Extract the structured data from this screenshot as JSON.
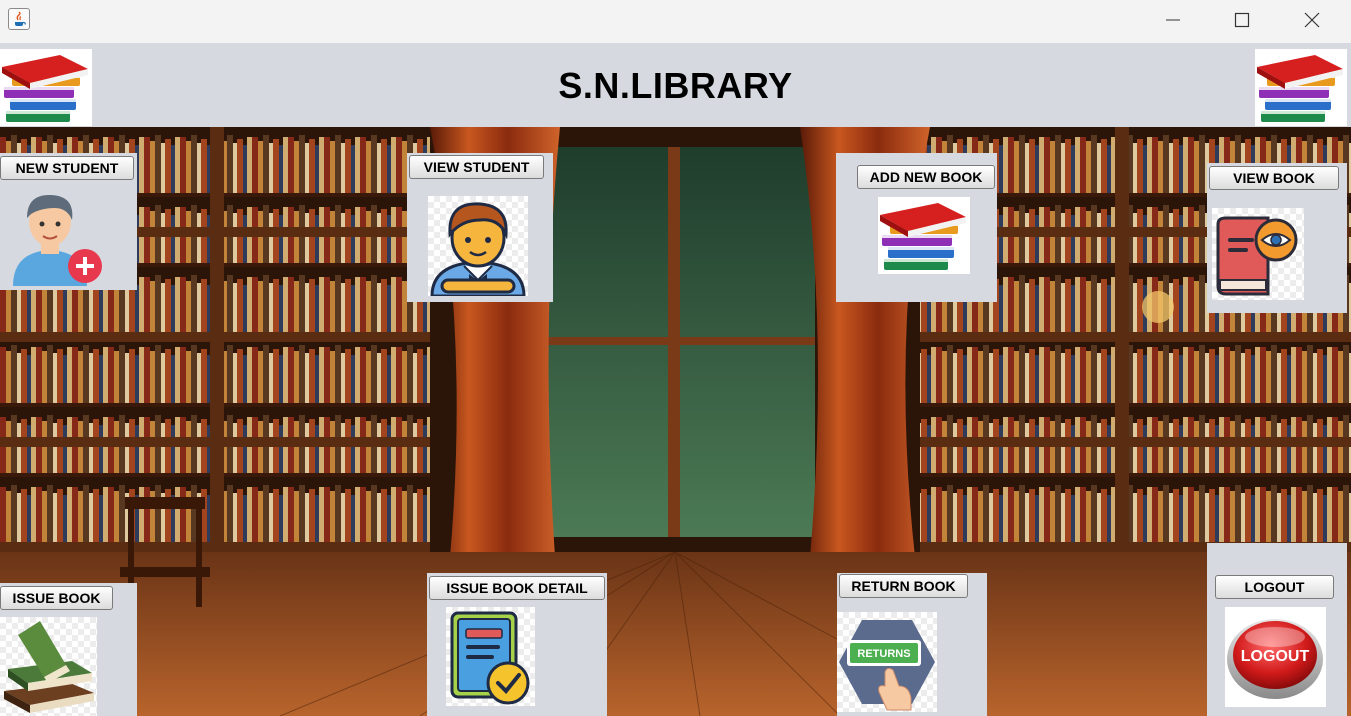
{
  "window": {
    "controls": [
      {
        "name": "minimize-button",
        "icon": "minimize-icon"
      },
      {
        "name": "maximize-button",
        "icon": "maximize-icon"
      },
      {
        "name": "close-button",
        "icon": "close-icon"
      }
    ]
  },
  "header": {
    "title": "S.N.LIBRARY",
    "left_icon": "books-stack-icon",
    "right_icon": "books-stack-icon"
  },
  "buttons": {
    "new_student": "NEW STUDENT",
    "view_student": "VIEW STUDENT",
    "add_new_book": "ADD NEW BOOK",
    "view_book": "VIEW BOOK",
    "issue_book": "ISSUE BOOK",
    "issue_book_detail": "ISSUE BOOK DETAIL",
    "return_book": "RETURN BOOK",
    "logout": "LOGOUT"
  },
  "images": {
    "returns_sign": "RETURNS",
    "logout_sign": "LOGOUT"
  },
  "colors": {
    "panel_bg": "#d6d9e0",
    "logout_red": "#d11a1a"
  }
}
